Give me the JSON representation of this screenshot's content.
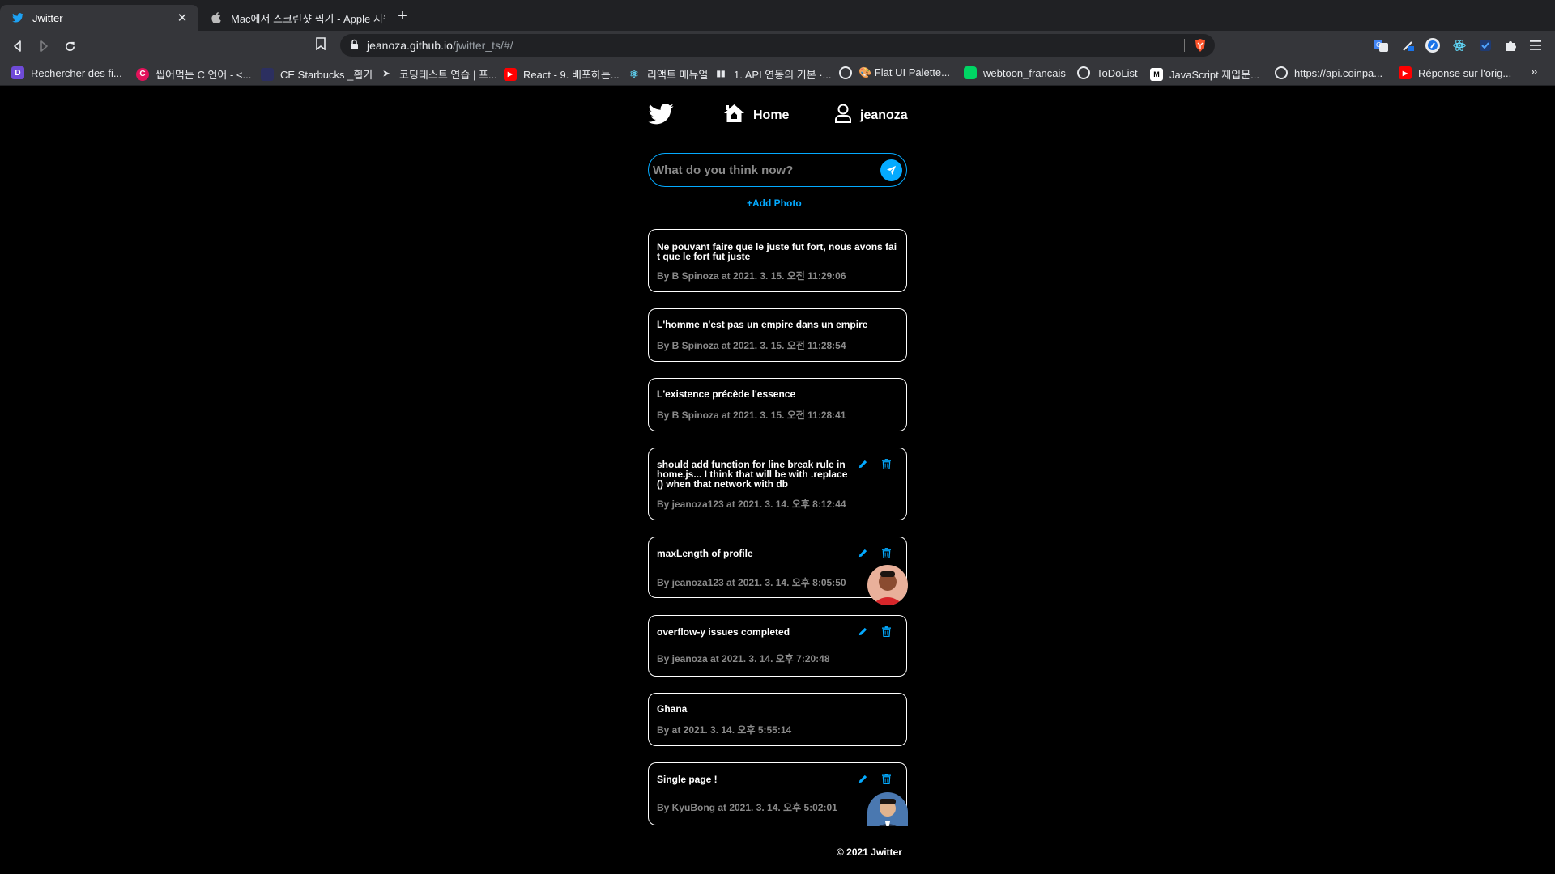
{
  "browser": {
    "tabs": [
      {
        "title": "Jwitter",
        "active": true
      },
      {
        "title": "Mac에서 스크린샷 찍기 - Apple 지원",
        "active": false
      }
    ],
    "url_host": "jeanoza.github.io",
    "url_path": "/jwitter_ts/#/",
    "bookmarks": [
      {
        "label": "Rechercher des fi...",
        "icon": "d-icon",
        "color": "#6f4bd8"
      },
      {
        "label": "씹어먹는 C 언어 - <...",
        "icon": "c-logo-icon",
        "color": "#e2125a"
      },
      {
        "label": "CE Starbucks _횝기",
        "icon": "page-icon",
        "color": "#2c2f60"
      },
      {
        "label": "코딩테스트 연습 | 프...",
        "icon": "arrow-icon",
        "color": "#e8eaed"
      },
      {
        "label": "React - 9. 배포하는...",
        "icon": "youtube-icon",
        "color": "#ff0000"
      },
      {
        "label": "리액트 매뉴얼",
        "icon": "react-icon",
        "color": "#61dafb"
      },
      {
        "label": "1. API 연동의 기본 ·...",
        "icon": "book-icon",
        "color": "#e8eaed"
      },
      {
        "label": "🎨 Flat UI Palette...",
        "icon": "globe-icon",
        "color": "#e8eaed"
      },
      {
        "label": "webtoon_francais",
        "icon": "webtoon-icon",
        "color": "#00d564"
      },
      {
        "label": "ToDoList",
        "icon": "globe-icon",
        "color": "#e8eaed"
      },
      {
        "label": "JavaScript 재입문...",
        "icon": "mdn-icon",
        "color": "#ffffff"
      },
      {
        "label": "https://api.coinpa...",
        "icon": "globe-icon",
        "color": "#e8eaed"
      },
      {
        "label": "Réponse sur l'orig...",
        "icon": "youtube-icon",
        "color": "#ff0000"
      }
    ],
    "bookmarks_more": "»"
  },
  "nav": {
    "home_label": "Home",
    "profile_label": "jeanoza"
  },
  "composer": {
    "placeholder": "What do you think now?",
    "value": "",
    "add_photo_label": "Add Photo"
  },
  "tweets": [
    {
      "text": "Ne pouvant faire que le juste fut fort, nous avons fait que le fort fut juste",
      "meta": "By B Spinoza at 2021. 3. 15. 오전 11:29:06",
      "owner": false,
      "avatar": null
    },
    {
      "text": "L'homme n'est pas un empire dans un empire",
      "meta": "By B Spinoza at 2021. 3. 15. 오전 11:28:54",
      "owner": false,
      "avatar": null
    },
    {
      "text": "L'existence précède l'essence",
      "meta": "By B Spinoza at 2021. 3. 15. 오전 11:28:41",
      "owner": false,
      "avatar": null
    },
    {
      "text": "should add function for line break rule in home.js... I think that will be with .replace() when that network with db",
      "meta": "By jeanoza123 at 2021. 3. 14. 오후 8:12:44",
      "owner": true,
      "avatar": null
    },
    {
      "text": "maxLength of profile",
      "meta": "By jeanoza123 at 2021. 3. 14. 오후 8:05:50",
      "owner": true,
      "avatar": "avatar-man-red-shirt"
    },
    {
      "text": "overflow-y issues completed",
      "meta": "By jeanoza at 2021. 3. 14. 오후 7:20:48",
      "owner": true,
      "avatar": null
    },
    {
      "text": "Ghana",
      "meta": "By at 2021. 3. 14. 오후 5:55:14",
      "owner": false,
      "avatar": null
    },
    {
      "text": "Single page !",
      "meta": "By KyuBong at 2021. 3. 14. 오후 5:02:01",
      "owner": true,
      "avatar": "avatar-man-suit"
    }
  ],
  "footer": {
    "text": "© 2021 Jwitter"
  },
  "colors": {
    "accent": "#04aaff",
    "background": "#000000",
    "meta_text": "#8a8a8a"
  }
}
